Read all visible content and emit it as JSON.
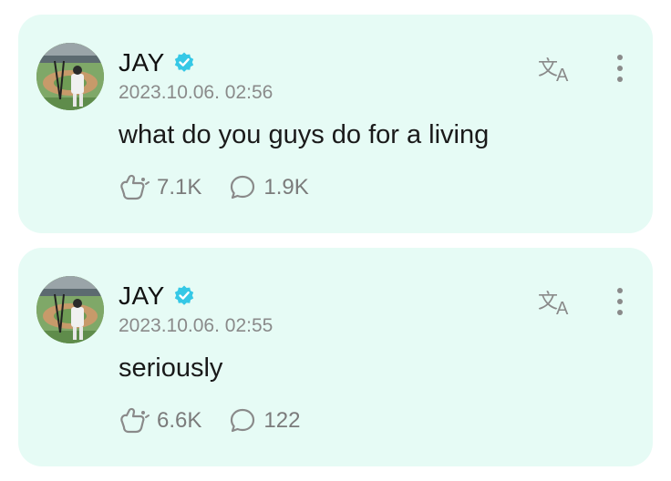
{
  "posts": [
    {
      "author": "JAY",
      "timestamp": "2023.10.06. 02:56",
      "text": "what do you guys do for a living",
      "reactions": "7.1K",
      "comments": "1.9K"
    },
    {
      "author": "JAY",
      "timestamp": "2023.10.06. 02:55",
      "text": "seriously",
      "reactions": "6.6K",
      "comments": "122"
    }
  ],
  "colors": {
    "card_bg": "#e6fbf5",
    "verified": "#35c8e6",
    "secondary_text": "#8a8a8a"
  },
  "icons": [
    "verified-badge-icon",
    "translate-icon",
    "more-options-icon",
    "reaction-icon",
    "comment-icon"
  ]
}
